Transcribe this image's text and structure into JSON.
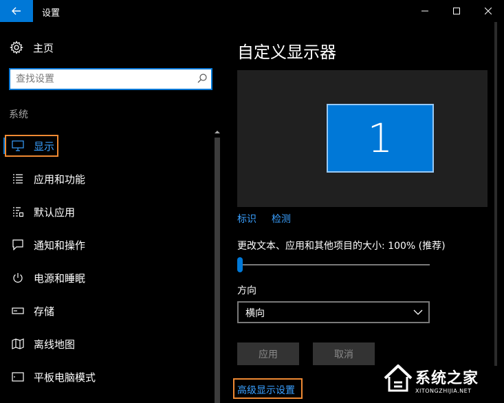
{
  "window": {
    "title": "设置"
  },
  "sidebar": {
    "home_label": "主页",
    "search": {
      "placeholder": "查找设置",
      "value": ""
    },
    "section_label": "系统",
    "items": [
      {
        "label": "显示",
        "icon": "monitor-icon",
        "active": true
      },
      {
        "label": "应用和功能",
        "icon": "list-icon"
      },
      {
        "label": "默认应用",
        "icon": "default-apps-icon"
      },
      {
        "label": "通知和操作",
        "icon": "notification-icon"
      },
      {
        "label": "电源和睡眠",
        "icon": "power-icon"
      },
      {
        "label": "存储",
        "icon": "storage-icon"
      },
      {
        "label": "离线地图",
        "icon": "map-icon"
      },
      {
        "label": "平板电脑模式",
        "icon": "tablet-icon"
      }
    ]
  },
  "main": {
    "title": "自定义显示器",
    "monitor_number": "1",
    "identify_link": "标识",
    "detect_link": "检测",
    "scale_label": "更改文本、应用和其他项目的大小: 100% (推荐)",
    "scale_slider_fraction": 0.0,
    "orientation_label": "方向",
    "orientation_value": "横向",
    "apply_button": "应用",
    "cancel_button": "取消",
    "advanced_link": "高级显示设置"
  },
  "watermark": {
    "text": "系统之家",
    "url": "XITONGZHIJIA.NET"
  },
  "colors": {
    "accent": "#0078d7",
    "link": "#3aa0ff",
    "highlight": "#f08a33"
  }
}
